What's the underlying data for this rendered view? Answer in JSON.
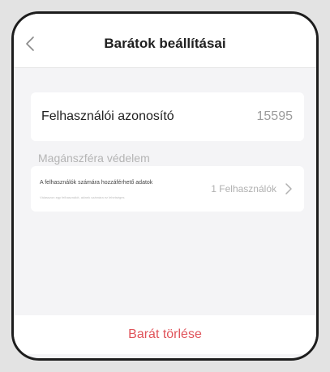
{
  "header": {
    "title": "Barátok beállításai",
    "back_icon": "chevron-left-icon"
  },
  "user_id_row": {
    "label": "Felhasználói azonosító",
    "value": "15595"
  },
  "privacy_section": {
    "title": "Magánszféra védelem",
    "access_row": {
      "label": "A felhasználók számára hozzáférhető adatok",
      "description": "Válasszon egy felhasználót, akinek számára ez lehetséges",
      "value": "1 Felhasználók",
      "chevron_icon": "chevron-right-icon"
    }
  },
  "delete_action": {
    "label": "Barát törlése",
    "color": "#e0535a"
  }
}
